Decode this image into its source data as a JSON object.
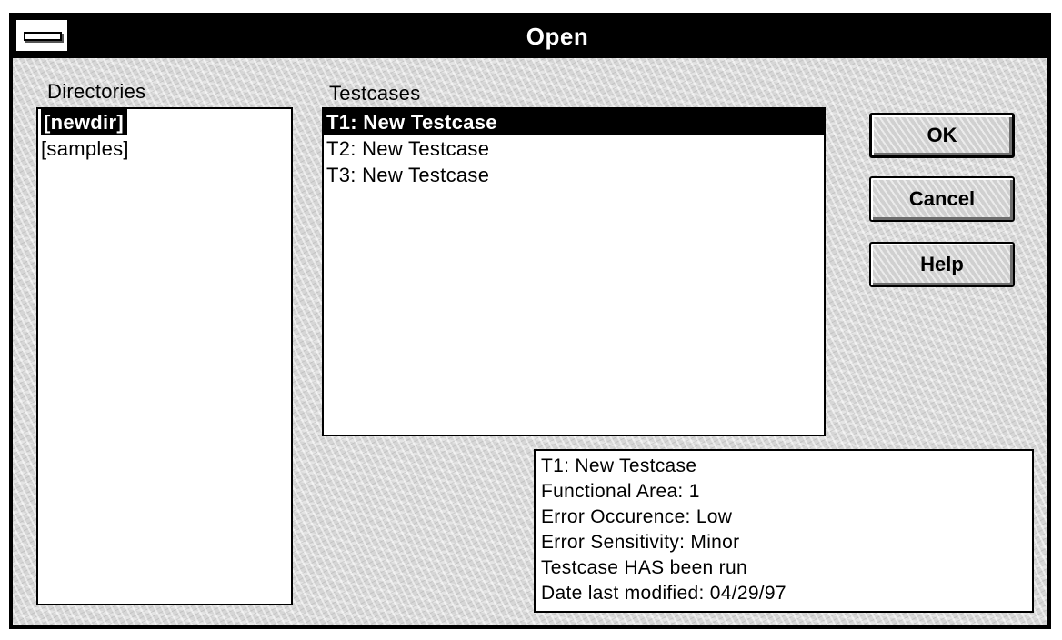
{
  "window": {
    "title": "Open"
  },
  "directories": {
    "label": "Directories",
    "items": [
      "[newdir]",
      "[samples]"
    ],
    "selected_index": 0
  },
  "testcases": {
    "label": "Testcases",
    "items": [
      "T1: New Testcase",
      "T2: New Testcase",
      "T3: New Testcase"
    ],
    "selected_index": 0
  },
  "buttons": {
    "ok": "OK",
    "cancel": "Cancel",
    "help": "Help"
  },
  "details": {
    "lines": [
      "T1: New Testcase",
      "Functional Area: 1",
      "Error Occurence: Low",
      "Error Sensitivity: Minor",
      "Testcase HAS been run",
      "Date last modified: 04/29/97"
    ]
  },
  "colors": {
    "titlebar": "#000000",
    "selection": "#000000",
    "dialog_background": "#d6d6d6"
  },
  "icons": {
    "system_menu": "system-menu-icon"
  }
}
